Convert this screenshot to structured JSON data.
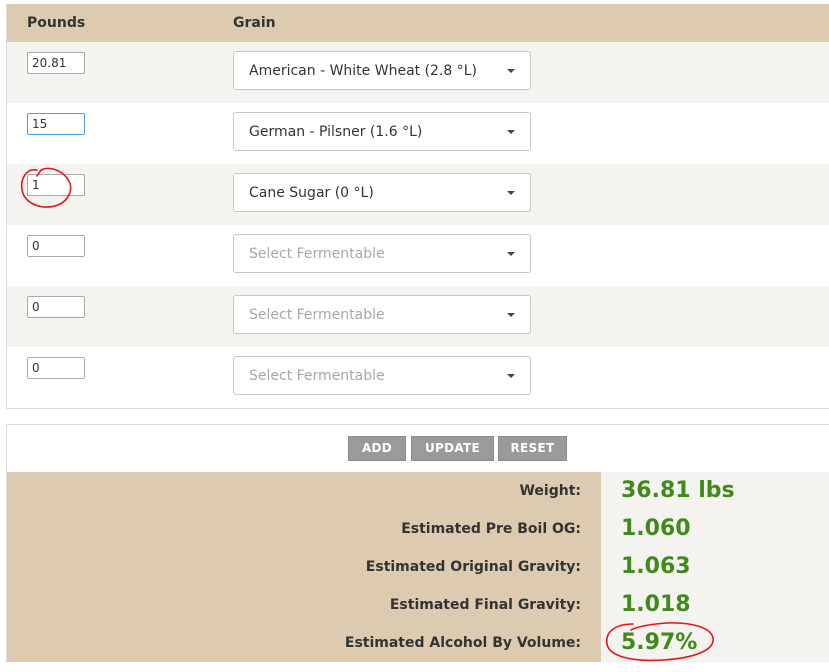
{
  "table": {
    "headers": {
      "pounds": "Pounds",
      "grain": "Grain"
    },
    "rows": [
      {
        "pounds": "20.81",
        "grain": "American - White Wheat (2.8 °L)"
      },
      {
        "pounds": "15",
        "grain": "German - Pilsner (1.6 °L)"
      },
      {
        "pounds": "1",
        "grain": "Cane Sugar (0 °L)"
      },
      {
        "pounds": "0",
        "grain": "Select Fermentable"
      },
      {
        "pounds": "0",
        "grain": "Select Fermentable"
      },
      {
        "pounds": "0",
        "grain": "Select Fermentable"
      }
    ]
  },
  "buttons": {
    "add": "ADD",
    "update": "UPDATE",
    "reset": "RESET"
  },
  "results": [
    {
      "label": "Weight:",
      "value": "36.81 lbs"
    },
    {
      "label": "Estimated Pre Boil OG:",
      "value": "1.060"
    },
    {
      "label": "Estimated Original Gravity:",
      "value": "1.063"
    },
    {
      "label": "Estimated Final Gravity:",
      "value": "1.018"
    },
    {
      "label": "Estimated Alcohol By Volume:",
      "value": "5.97%"
    }
  ],
  "colors": {
    "header_bg": "#dccbb0",
    "row_alt_bg": "#f4f3f0",
    "value_green": "#3f8a1a",
    "button_gray": "#9a9a9a",
    "annotation_red": "#e8141a",
    "focus_blue": "#4aa3df"
  },
  "annotations": [
    "red-circle-around-cane-sugar-pounds",
    "red-circle-around-abv-value"
  ]
}
